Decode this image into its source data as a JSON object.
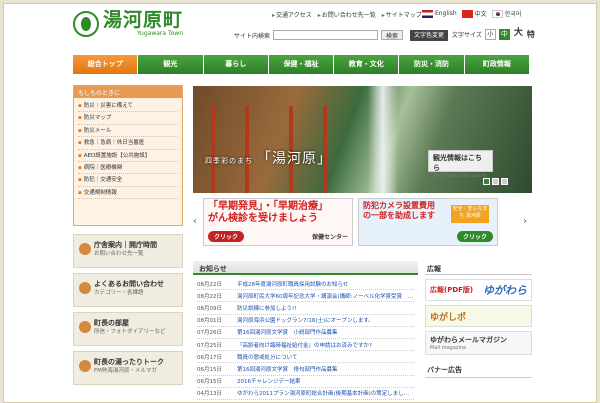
{
  "header": {
    "logo_title": "湯河原町",
    "logo_sub": "Yugawara Town",
    "top_links": [
      "交通アクセス",
      "お問い合わせ先一覧",
      "サイトマップ"
    ],
    "languages": [
      "English",
      "中文",
      "한국어"
    ],
    "search_label": "サイト内検索",
    "search_button": "検索",
    "mode_button": "文字色変更",
    "font_size_label": "文字サイズ",
    "font_sizes": [
      "小",
      "中",
      "大",
      "特"
    ]
  },
  "nav": [
    "総合トップ",
    "観光",
    "暮らし",
    "保健・福祉",
    "教育・文化",
    "防災・消防",
    "町政情報"
  ],
  "sidebar": {
    "emergency_title": "もしものときに",
    "emergency_items": [
      "防災｜災害に備えて",
      "防災マップ",
      "防災メール",
      "救急｜急病｜休日当番医",
      "AED設置施設【公共施設】",
      "病院｜医療機関",
      "防犯｜交通安全",
      "交通規制情報"
    ],
    "cards": [
      {
        "title": "庁舎案内｜開庁時間",
        "sub": "お問い合わせ先一覧"
      },
      {
        "title": "よくあるお問い合わせ",
        "sub": "カテゴリー・各課語"
      },
      {
        "title": "町長の部屋",
        "sub": "所信・フォトダイアリーなど"
      },
      {
        "title": "町長の湯ったりトーク",
        "sub": "FM熱海湯河原・メルマガ"
      }
    ]
  },
  "hero": {
    "caption_small": "四季彩のまち",
    "caption_main": "「湯河原」",
    "tag_title": "観光情報はこちら",
    "tag_sub": "The details this place"
  },
  "banners": [
    {
      "line1": "「早期発見」・「早期治療」",
      "line2": "がん検診を受けましょう",
      "click": "クリック",
      "org": "保健センター"
    },
    {
      "line1": "防犯カメラ設置費用",
      "line2": "の一部を助成します",
      "note": "安全・安心なまち 湯河原",
      "click": "クリック"
    }
  ],
  "news": {
    "title": "お知らせ",
    "items": [
      {
        "date": "08月22日",
        "title": "平成28年度湯河原町職員採用試験のお知らせ"
      },
      {
        "date": "08月22日",
        "title": "湯河原町民大学60周年記念大学・講演会(講師:ノーベル化学賞受賞　野依良治先生)～来場者募集"
      },
      {
        "date": "08月09日",
        "title": "防災訓練に参加しよう!!"
      },
      {
        "date": "08月01日",
        "title": "湯河原海浜公園ドッグラン7/16(土)にオープンします。"
      },
      {
        "date": "07月26日",
        "title": "第16回湯河原文学賞　小説部門作品募集"
      },
      {
        "date": "07月25日",
        "title": "『高齢者向け臨時福祉給付金』の申請はお済みですか?"
      },
      {
        "date": "06月17日",
        "title": "職員の懲戒処分について"
      },
      {
        "date": "06月15日",
        "title": "第16回湯河原文学賞　俳句部門作品募集"
      },
      {
        "date": "06月15日",
        "title": "2016チャレンジデー結果"
      },
      {
        "date": "04月13日",
        "title": "ゆがわら2011プラン湯河原町総合計画(後期基本計画)の策定しました。"
      }
    ]
  },
  "ads": {
    "title": "広報",
    "pdf_label": "広報(PDF版)",
    "pdf_logo": "ゆがわら",
    "blog_label": "ゆがしポ",
    "mail_label": "ゆがわらメールマガジン",
    "mail_sub": "Mail magazine",
    "banner_title": "バナー広告"
  }
}
